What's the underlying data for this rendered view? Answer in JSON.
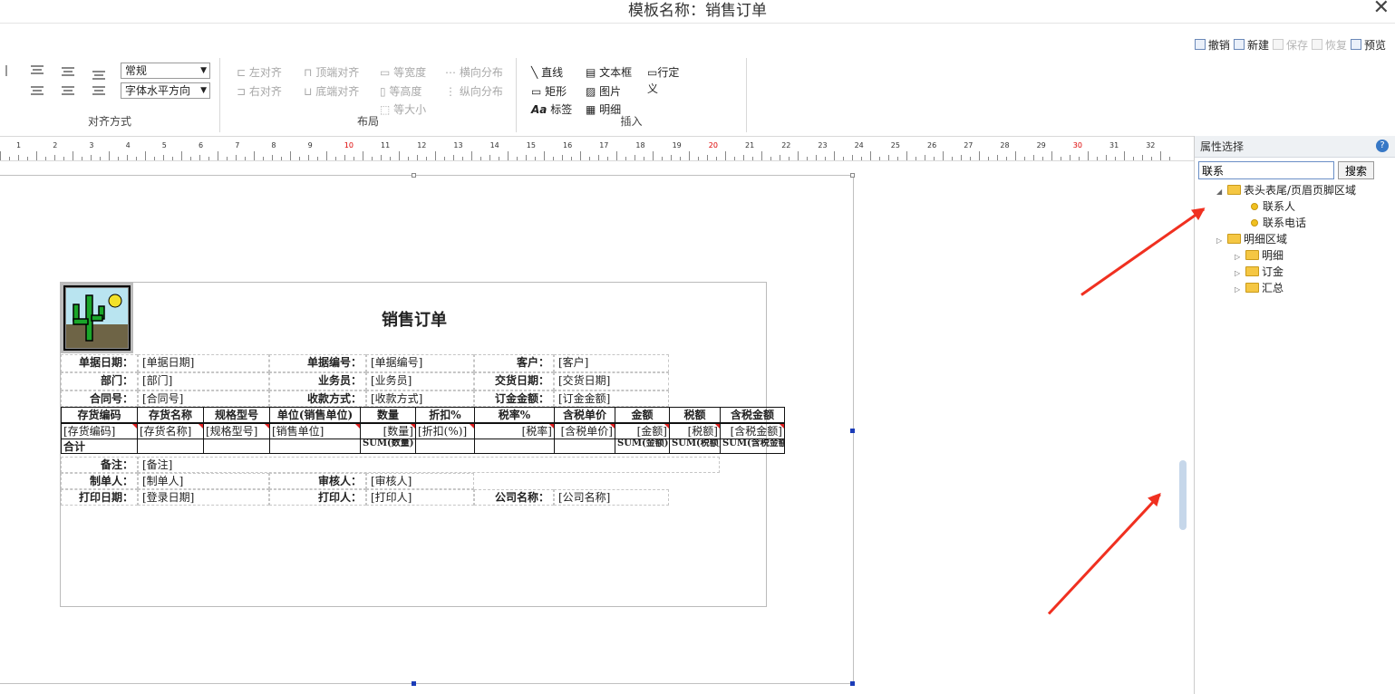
{
  "window": {
    "title": "模板名称：销售订单",
    "close": "✕"
  },
  "toolbar": {
    "undo": "撤销",
    "new": "新建",
    "save": "保存",
    "restore": "恢复",
    "preview": "预览"
  },
  "ribbon": {
    "align_group": {
      "label": "对齐方式",
      "font_style": "常规",
      "h_align": "字体水平方向"
    },
    "layout_group": {
      "label": "布局",
      "left_align": "左对齐",
      "top_align": "顶端对齐",
      "equal_width": "等宽度",
      "h_distribute": "横向分布",
      "right_align": "右对齐",
      "bottom_align": "底端对齐",
      "equal_height": "等高度",
      "v_distribute": "纵向分布",
      "equal_size": "等大小"
    },
    "insert_group": {
      "label": "插入",
      "line": "直线",
      "textbox": "文本框",
      "custom_row": "行定义",
      "rect": "矩形",
      "image": "图片",
      "label_tool": "标签",
      "detail": "明细"
    }
  },
  "ruler": {
    "marks": [
      "1",
      "2",
      "3",
      "4",
      "5",
      "6",
      "7",
      "8",
      "9",
      "10",
      "11",
      "12",
      "13",
      "14",
      "15",
      "16",
      "17",
      "18",
      "19",
      "20",
      "21",
      "22",
      "23",
      "24",
      "25",
      "26",
      "27",
      "28",
      "29",
      "30",
      "31",
      "32"
    ],
    "red": [
      "10",
      "20",
      "30"
    ]
  },
  "report": {
    "title": "销售订单",
    "header": [
      {
        "label": "单据日期：",
        "value": "[单据日期]"
      },
      {
        "label": "单据编号：",
        "value": "[单据编号]"
      },
      {
        "label": "客户：",
        "value": "[客户]"
      },
      {
        "label": "部门：",
        "value": "[部门]"
      },
      {
        "label": "业务员：",
        "value": "[业务员]"
      },
      {
        "label": "交货日期：",
        "value": "[交货日期]"
      },
      {
        "label": "合同号：",
        "value": "[合同号]"
      },
      {
        "label": "收款方式：",
        "value": "[收款方式]"
      },
      {
        "label": "订金金额：",
        "value": "[订金金额]"
      }
    ],
    "columns": [
      "存货编码",
      "存货名称",
      "规格型号",
      "单位(销售单位)",
      "数量",
      "折扣%",
      "税率%",
      "含税单价",
      "金额",
      "税额",
      "含税金额"
    ],
    "detail_row": [
      "[存货编码]",
      "[存货名称]",
      "[规格型号]",
      "[销售单位]",
      "[数量]",
      "[折扣(%)]",
      "[税率]",
      "[含税单价]",
      "[金额]",
      "[税额]",
      "[含税金额]"
    ],
    "total_label": "合计",
    "sum_quantity": "SUM(数量)",
    "sum_amount": "SUM(金额)",
    "sum_tax": "SUM(税额)",
    "sum_total": "SUM(含税金额)",
    "footer": [
      {
        "label": "备注：",
        "value": "[备注]"
      },
      {
        "label": "制单人：",
        "value": "[制单人]"
      },
      {
        "label": "审核人：",
        "value": "[审核人]"
      },
      {
        "label": "打印日期：",
        "value": "[登录日期]"
      },
      {
        "label": "打印人：",
        "value": "[打印人]"
      },
      {
        "label": "公司名称：",
        "value": "[公司名称]"
      }
    ]
  },
  "panel": {
    "title": "属性选择",
    "help": "?",
    "search_value": "联系",
    "search_button": "搜索",
    "tree": {
      "header_footer": "表头表尾/页眉页脚区域",
      "contact_person": "联系人",
      "contact_phone": "联系电话",
      "detail_area": "明细区域",
      "detail": "明细",
      "deposit": "订金",
      "summary": "汇总"
    }
  },
  "colors": {
    "arrow": "#f03020",
    "selection_handle": "#1b3cb8",
    "accent": "#3778c6"
  }
}
